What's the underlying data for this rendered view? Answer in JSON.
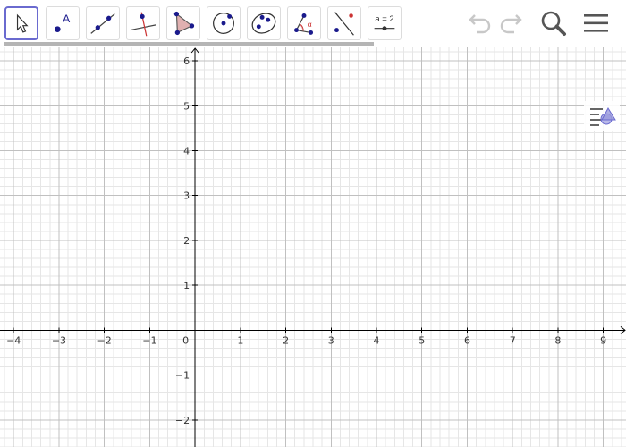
{
  "toolbar": {
    "tools": [
      {
        "name": "move-tool",
        "icon": "arrow-cursor-icon"
      },
      {
        "name": "point-tool",
        "icon": "point-label-icon",
        "label": "A"
      },
      {
        "name": "line-tool",
        "icon": "line-through-points-icon"
      },
      {
        "name": "perpendicular-line-tool",
        "icon": "perpendicular-line-icon"
      },
      {
        "name": "polygon-tool",
        "icon": "polygon-icon"
      },
      {
        "name": "circle-tool",
        "icon": "circle-center-point-icon"
      },
      {
        "name": "conic-tool",
        "icon": "ellipse-icon"
      },
      {
        "name": "angle-tool",
        "icon": "angle-icon",
        "label": "α"
      },
      {
        "name": "reflect-tool",
        "icon": "reflect-about-line-icon"
      },
      {
        "name": "slider-tool",
        "icon": "slider-icon",
        "label": "a = 2"
      }
    ],
    "actions": [
      {
        "name": "undo-button",
        "icon": "undo-icon"
      },
      {
        "name": "redo-button",
        "icon": "redo-icon"
      },
      {
        "name": "search-button",
        "icon": "search-icon"
      },
      {
        "name": "menu-button",
        "icon": "hamburger-menu-icon"
      }
    ]
  },
  "graph": {
    "x_ticks": [
      "−4",
      "−3",
      "−2",
      "−1",
      "0",
      "1",
      "2",
      "3",
      "4",
      "5",
      "6",
      "7",
      "8",
      "9"
    ],
    "y_ticks": [
      "6",
      "5",
      "4",
      "3",
      "2",
      "1",
      "−1",
      "−2"
    ],
    "x_range": [
      -4.3,
      9.5
    ],
    "y_range": [
      -2.6,
      6.3
    ],
    "grid": true,
    "axis_color": "#000000",
    "major_grid_color": "#c0c0c0",
    "minor_grid_color": "#e6e6e6"
  },
  "style_bar": {
    "icon": "style-bar-toggle-icon"
  },
  "colors": {
    "accent": "#6a6acf",
    "point": "#1a1a8c",
    "polygon_fill": "#e0b0b0",
    "angle": "#cc3333"
  }
}
